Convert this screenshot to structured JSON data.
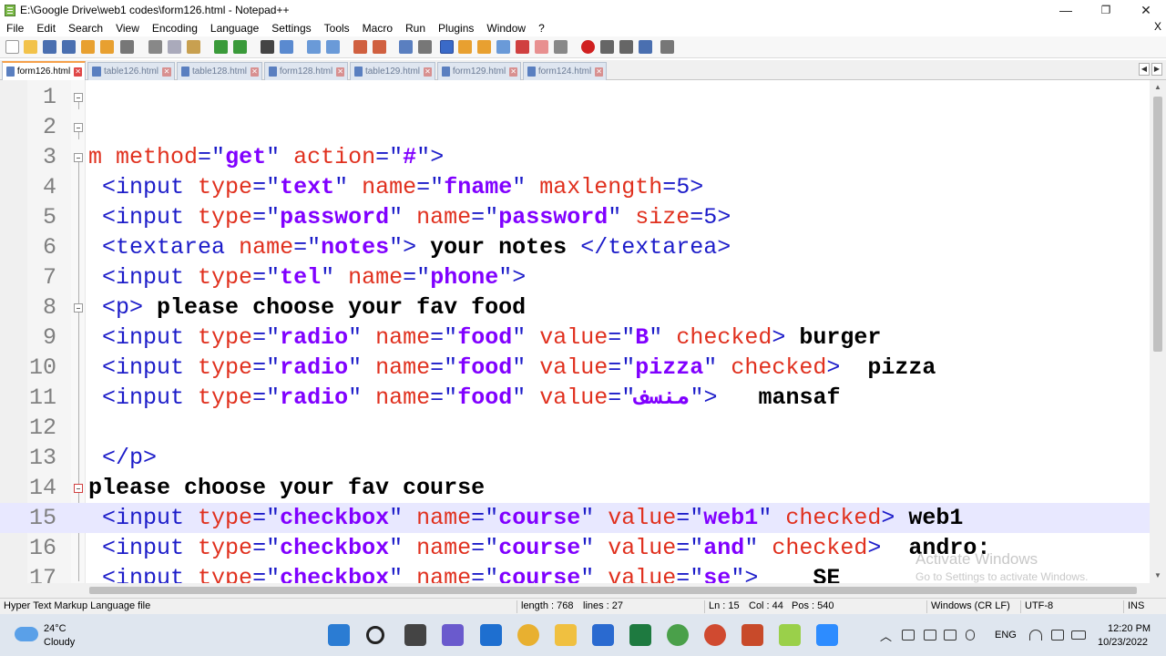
{
  "window": {
    "title": "E:\\Google Drive\\web1 codes\\form126.html - Notepad++",
    "minimize": "—",
    "maximize": "❐",
    "close": "✕"
  },
  "menu": {
    "items": [
      "File",
      "Edit",
      "Search",
      "View",
      "Encoding",
      "Language",
      "Settings",
      "Tools",
      "Macro",
      "Run",
      "Plugins",
      "Window",
      "?"
    ],
    "close": "X"
  },
  "tabs": [
    {
      "label": "form126.html",
      "active": true
    },
    {
      "label": "table126.html",
      "active": false
    },
    {
      "label": "table128.html",
      "active": false
    },
    {
      "label": "form128.html",
      "active": false
    },
    {
      "label": "table129.html",
      "active": false
    },
    {
      "label": "form129.html",
      "active": false
    },
    {
      "label": "form124.html",
      "active": false
    }
  ],
  "editor": {
    "lines": [
      {
        "n": "1",
        "text": ""
      },
      {
        "n": "2",
        "text": ""
      },
      {
        "n": "3",
        "text": "m method=\"get\" action=\"#\">"
      },
      {
        "n": "4",
        "text": " <input type=\"text\" name=\"fname\" maxlength=5>"
      },
      {
        "n": "5",
        "text": " <input type=\"password\" name=\"password\" size=5>"
      },
      {
        "n": "6",
        "text": " <textarea name=\"notes\"> your notes </textarea>"
      },
      {
        "n": "7",
        "text": " <input type=\"tel\" name=\"phone\">"
      },
      {
        "n": "8",
        "text": " <p> please choose your fav food"
      },
      {
        "n": "9",
        "text": " <input type=\"radio\" name=\"food\" value=\"B\" checked> burger"
      },
      {
        "n": "10",
        "text": " <input type=\"radio\" name=\"food\" value=\"pizza\" checked>  pizza"
      },
      {
        "n": "11",
        "text": " <input type=\"radio\" name=\"food\" value=\"منسف\">   mansaf"
      },
      {
        "n": "12",
        "text": ""
      },
      {
        "n": "13",
        "text": " </p>"
      },
      {
        "n": "14",
        "text": "please choose your fav course"
      },
      {
        "n": "15",
        "text": " <input type=\"checkbox\" name=\"course\" value=\"web1\" checked> web1"
      },
      {
        "n": "16",
        "text": " <input type=\"checkbox\" name=\"course\" value=\"and\" checked>  andro:"
      },
      {
        "n": "17",
        "text": " <input type=\"checkbox\" name=\"course\" value=\"se\">    SE"
      }
    ],
    "current_line": "15"
  },
  "watermark": {
    "line1": "Activate Windows",
    "line2": "Go to Settings to activate Windows."
  },
  "status": {
    "file_type": "Hyper Text Markup Language file",
    "length": "length : 768",
    "lines": "lines : 27",
    "ln": "Ln : 15",
    "col": "Col : 44",
    "pos": "Pos : 540",
    "eol": "Windows (CR LF)",
    "encoding": "UTF-8",
    "mode": "INS"
  },
  "taskbar": {
    "temp": "24°C",
    "weather": "Cloudy",
    "lang": "ENG",
    "time": "12:20 PM",
    "date": "10/23/2022"
  }
}
